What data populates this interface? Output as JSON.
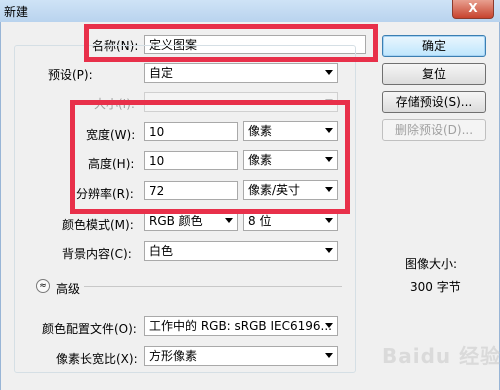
{
  "window": {
    "title": "新建",
    "close_label": "X"
  },
  "fields": {
    "name": {
      "label": "名称(N):",
      "value": "定义图案"
    },
    "preset": {
      "label": "预设(P):",
      "value": "自定"
    },
    "size": {
      "label": "大小(I):",
      "value": ""
    },
    "width": {
      "label": "宽度(W):",
      "value": "10",
      "unit": "像素"
    },
    "height": {
      "label": "高度(H):",
      "value": "10",
      "unit": "像素"
    },
    "resolution": {
      "label": "分辨率(R):",
      "value": "72",
      "unit": "像素/英寸"
    },
    "color_mode": {
      "label": "颜色模式(M):",
      "mode": "RGB 颜色",
      "depth": "8 位"
    },
    "background": {
      "label": "背景内容(C):",
      "value": "白色"
    },
    "advanced": {
      "label": "高级",
      "toggle_icon": "≈"
    },
    "color_profile": {
      "label": "颜色配置文件(O):",
      "value": "工作中的 RGB: sRGB IEC6196..."
    },
    "pixel_aspect": {
      "label": "像素长宽比(X):",
      "value": "方形像素"
    }
  },
  "buttons": {
    "ok": "确定",
    "reset": "复位",
    "save_preset": "存储预设(S)...",
    "delete_preset": "删除预设(D)..."
  },
  "image_size": {
    "label": "图像大小:",
    "value": "300 字节"
  },
  "watermark": "Baidu 经验",
  "colors": {
    "highlight": "#e8304a",
    "titlebar": "#b9d3ee"
  }
}
